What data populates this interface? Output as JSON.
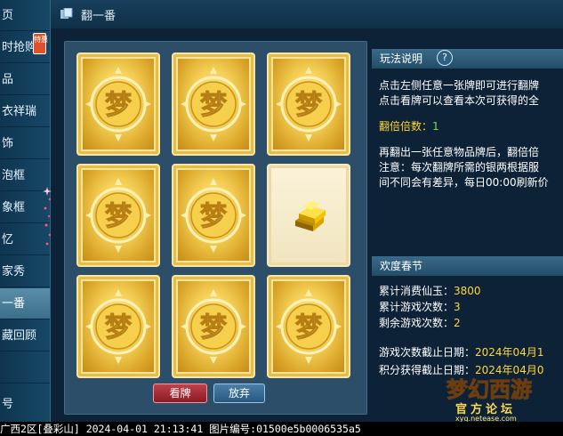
{
  "sidebar": {
    "items": [
      {
        "label": "页",
        "active": false
      },
      {
        "label": "时抢购",
        "active": false,
        "badge": "特惠"
      },
      {
        "label": "品",
        "active": false
      },
      {
        "label": "衣祥瑞",
        "active": false
      },
      {
        "label": "饰",
        "active": false
      },
      {
        "label": "泡框",
        "active": false
      },
      {
        "label": "象框",
        "active": false
      },
      {
        "label": "忆",
        "active": false
      },
      {
        "label": "家秀",
        "active": false
      },
      {
        "label": "一番",
        "active": true
      },
      {
        "label": "藏回顾",
        "active": false
      },
      {
        "label": "",
        "active": false
      },
      {
        "label": "号",
        "active": false
      }
    ]
  },
  "header": {
    "title": "翻一番"
  },
  "board": {
    "cards": [
      {
        "state": "back"
      },
      {
        "state": "back"
      },
      {
        "state": "back"
      },
      {
        "state": "back"
      },
      {
        "state": "back"
      },
      {
        "state": "revealed",
        "content": "gold-ingots"
      },
      {
        "state": "back"
      },
      {
        "state": "back"
      },
      {
        "state": "back"
      }
    ],
    "card_glyph": "梦",
    "view_button": "看牌",
    "quit_button": "放弃"
  },
  "rules": {
    "title": "玩法说明",
    "help": "?",
    "line1": "点击左侧任意一张牌即可进行翻牌",
    "line2": "点击看牌可以查看本次可获得的全",
    "multiplier_label": "翻倍倍数：",
    "multiplier_value": "1",
    "line3": "再翻出一张任意物品牌后，翻倍倍",
    "line4": "注意：每次翻牌所需的银两根据服",
    "line5": "间不同会有差异，每日00:00刷新价"
  },
  "event": {
    "title": "欢度春节",
    "consumed_label": "累计消费仙玉：",
    "consumed_value": "3800",
    "total_plays_label": "累计游戏次数：",
    "total_plays_value": "3",
    "remaining_label": "剩余游戏次数：",
    "remaining_value": "2",
    "deadline_label": "游戏次数截止日期：",
    "deadline_value": "2024年04月1",
    "points_label": "积分获得截止日期：",
    "points_value": "2024年04月0"
  },
  "watermark": {
    "logo": "梦幻西游",
    "sub": "官方论坛",
    "url": "xyq.netease.com"
  },
  "status_bar": {
    "text": "广西2区[叠彩山] 2024-04-01 21:13:41 图片编号:01500e5b0006535a5"
  },
  "colors": {
    "accent_yellow": "#ffd834",
    "accent_green": "#73e04c",
    "gold": "#f4cf55"
  }
}
